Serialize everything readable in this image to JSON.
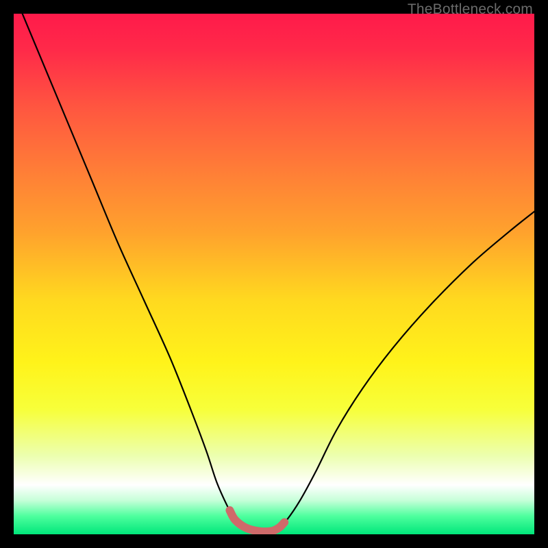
{
  "watermark": "TheBottleneck.com",
  "colors": {
    "frame": "#000000",
    "curve_stroke": "#000000",
    "valley_stroke": "#cf6a6a",
    "gradient_stops": [
      {
        "offset": 0.0,
        "color": "#ff1a4a"
      },
      {
        "offset": 0.07,
        "color": "#ff2a49"
      },
      {
        "offset": 0.18,
        "color": "#ff5640"
      },
      {
        "offset": 0.3,
        "color": "#ff7d37"
      },
      {
        "offset": 0.42,
        "color": "#ffa22d"
      },
      {
        "offset": 0.55,
        "color": "#ffd91f"
      },
      {
        "offset": 0.67,
        "color": "#fff31a"
      },
      {
        "offset": 0.76,
        "color": "#f7ff3a"
      },
      {
        "offset": 0.85,
        "color": "#ecffb0"
      },
      {
        "offset": 0.905,
        "color": "#ffffff"
      },
      {
        "offset": 0.935,
        "color": "#c6ffd8"
      },
      {
        "offset": 0.965,
        "color": "#4eff9e"
      },
      {
        "offset": 1.0,
        "color": "#00e67a"
      }
    ]
  },
  "chart_data": {
    "type": "line",
    "title": "",
    "xlabel": "",
    "ylabel": "",
    "x_range": [
      0,
      100
    ],
    "y_range": [
      0,
      100
    ],
    "series": [
      {
        "name": "bottleneck-curve",
        "x": [
          0,
          5,
          10,
          15,
          20,
          25,
          30,
          34,
          37,
          39,
          41,
          42.5,
          44.5,
          47,
          49.5,
          51,
          52.5,
          55,
          58,
          62,
          67,
          73,
          80,
          88,
          95,
          100
        ],
        "values": [
          104,
          92,
          80,
          68,
          56,
          45,
          34,
          24,
          16,
          10,
          5.5,
          2.8,
          1.3,
          0.6,
          0.6,
          1.3,
          2.8,
          6.5,
          12,
          20,
          28,
          36,
          44,
          52,
          58,
          62
        ]
      }
    ],
    "valley_highlight": {
      "x_start": 41.5,
      "x_end": 52.0
    }
  }
}
